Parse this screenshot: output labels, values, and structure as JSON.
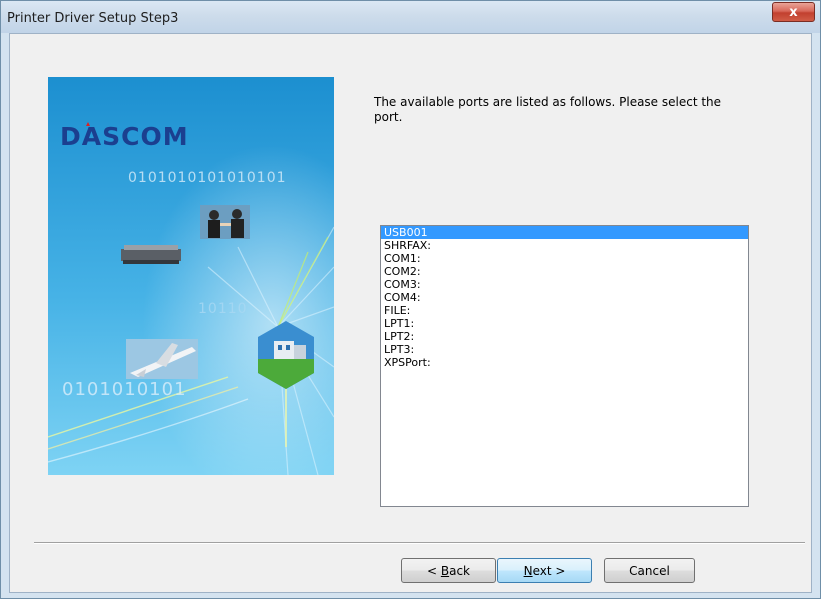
{
  "window": {
    "title": "Printer Driver Setup Step3",
    "close_glyph": "x"
  },
  "banner": {
    "logo": "DASCOM",
    "binary_top": "0101010101010101",
    "binary_mid": "10110",
    "binary_bottom": "0101010101",
    "colors": {
      "sky_top": "#1c8fd0",
      "sky_bottom": "#7ed3f4",
      "logo": "#1b3f8f",
      "logo_accent": "#e02020"
    }
  },
  "instructions": {
    "text": "The available ports are listed as follows. Please select the port."
  },
  "ports": {
    "items": [
      "USB001",
      "SHRFAX:",
      "COM1:",
      "COM2:",
      "COM3:",
      "COM4:",
      "FILE:",
      "LPT1:",
      "LPT2:",
      "LPT3:",
      "XPSPort:"
    ],
    "selected": "USB001",
    "selection_color": "#3399ff"
  },
  "buttons": {
    "back": {
      "prefix": "< ",
      "mnemonic": "B",
      "rest": "ack"
    },
    "next": {
      "prefix": "",
      "mnemonic": "N",
      "rest": "ext >"
    },
    "cancel": {
      "label": "Cancel"
    }
  }
}
